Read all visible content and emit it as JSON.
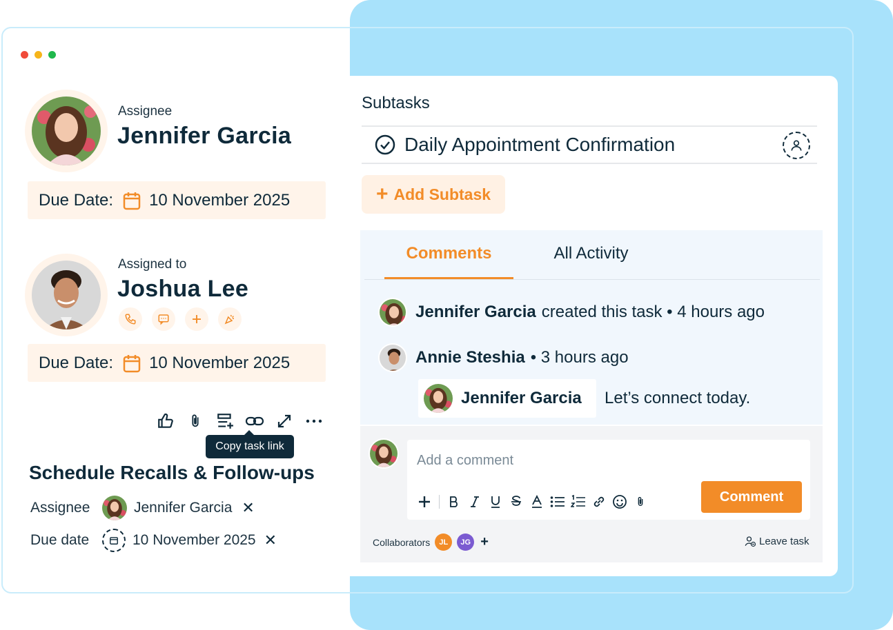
{
  "window": {
    "dots": [
      "#f04b3a",
      "#f6b51a",
      "#1fb84c"
    ]
  },
  "assignee_card": {
    "label": "Assignee",
    "name": "Jennifer Garcia",
    "due_label": "Due Date:",
    "due_value": "10 November 2025"
  },
  "assigned_card": {
    "label": "Assigned to",
    "name": "Joshua Lee",
    "actions": [
      "phone-icon",
      "chat-icon",
      "plus-icon",
      "celebrate-icon"
    ],
    "due_label": "Due Date:",
    "due_value": "10 November 2025"
  },
  "toolbar": {
    "icons": [
      "thumbs-up-icon",
      "paperclip-icon",
      "add-list-icon",
      "link-icon",
      "expand-icon",
      "more-icon"
    ],
    "tooltip": "Copy task link"
  },
  "task": {
    "title": "Schedule Recalls & Follow-ups",
    "assignee_label": "Assignee",
    "assignee_name": "Jennifer Garcia",
    "due_label": "Due date",
    "due_value": "10 November 2025",
    "remove_glyph": "✕"
  },
  "subtasks": {
    "heading": "Subtasks",
    "items": [
      {
        "label": "Daily Appointment Confirmation"
      }
    ],
    "add_label": "Add Subtask",
    "add_glyph": "+"
  },
  "tabs": [
    {
      "label": "Comments",
      "active": true
    },
    {
      "label": "All Activity",
      "active": false
    }
  ],
  "activity": [
    {
      "author": "Jennifer Garcia",
      "text": "created this task • 4 hours ago"
    },
    {
      "author": "Annie Steshia",
      "text": "• 3 hours ago"
    }
  ],
  "reply": {
    "author": "Jennifer Garcia",
    "text": "Let’s connect today."
  },
  "composer": {
    "placeholder": "Add a comment",
    "button": "Comment",
    "format_tools": [
      "plus-icon",
      "bold-icon",
      "italic-icon",
      "underline-icon",
      "strikethrough-icon",
      "text-color-icon",
      "bullet-list-icon",
      "numbered-list-icon",
      "link-icon",
      "emoji-icon",
      "paperclip-icon"
    ]
  },
  "collaborators": {
    "label": "Collaborators",
    "people": [
      {
        "initials": "JL",
        "color": "#f28c28"
      },
      {
        "initials": "JG",
        "color": "#7b5bd1"
      }
    ],
    "add_glyph": "+",
    "leave_label": "Leave task"
  },
  "colors": {
    "accent": "#f28c28",
    "navy": "#0f2a3a",
    "sky": "#a8e2fb",
    "peach": "#fff4ea"
  }
}
